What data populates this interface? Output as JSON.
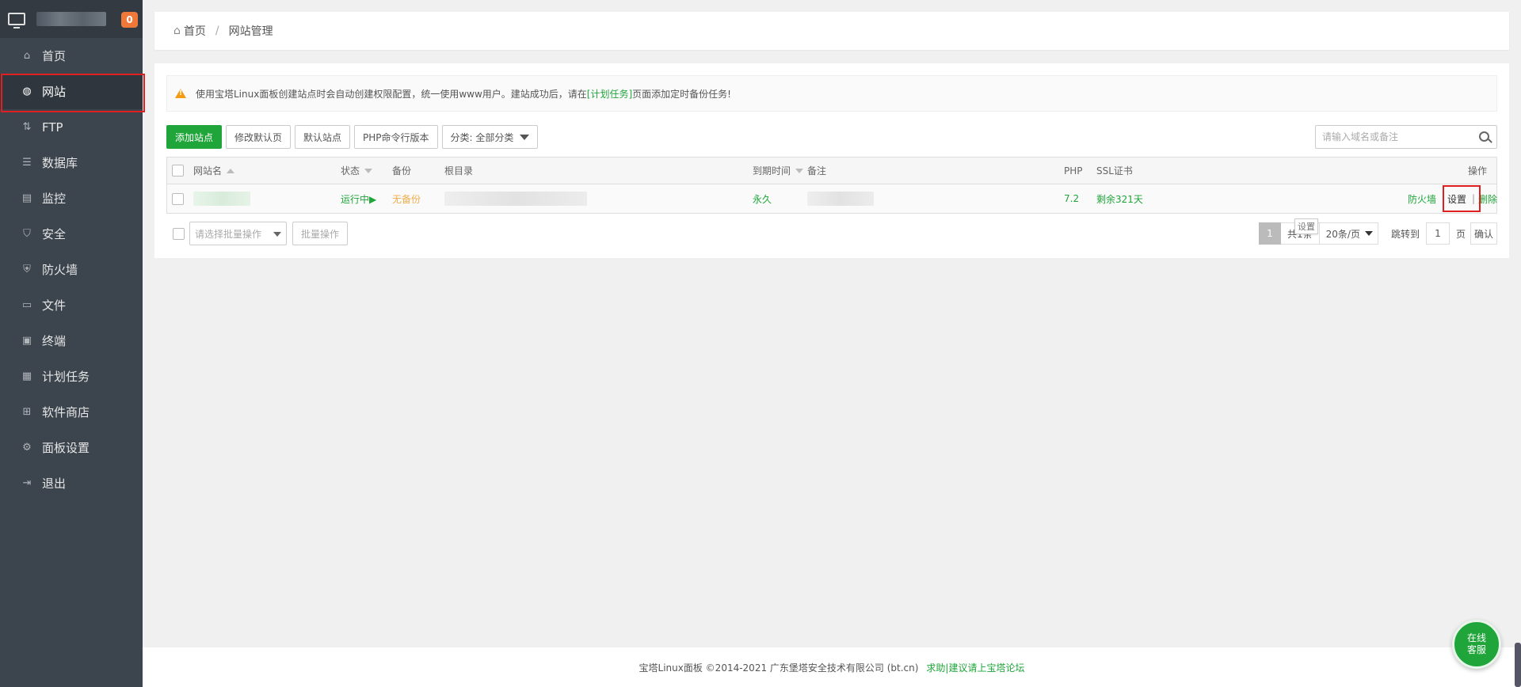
{
  "sidebar": {
    "badge_count": "0",
    "items": [
      {
        "label": "首页",
        "icon": "home-icon"
      },
      {
        "label": "网站",
        "icon": "globe-icon"
      },
      {
        "label": "FTP",
        "icon": "ftp-icon"
      },
      {
        "label": "数据库",
        "icon": "database-icon"
      },
      {
        "label": "监控",
        "icon": "monitor-icon"
      },
      {
        "label": "安全",
        "icon": "shield-icon"
      },
      {
        "label": "防火墙",
        "icon": "firewall-icon"
      },
      {
        "label": "文件",
        "icon": "folder-icon"
      },
      {
        "label": "终端",
        "icon": "terminal-icon"
      },
      {
        "label": "计划任务",
        "icon": "calendar-icon"
      },
      {
        "label": "软件商店",
        "icon": "grid-icon"
      },
      {
        "label": "面板设置",
        "icon": "gear-icon"
      },
      {
        "label": "退出",
        "icon": "logout-icon"
      }
    ]
  },
  "breadcrumb": {
    "home": "首页",
    "sep": "/",
    "current": "网站管理"
  },
  "notice": {
    "text_before": "使用宝塔Linux面板创建站点时会自动创建权限配置，统一使用www用户。建站成功后，请在",
    "link": "[计划任务]",
    "text_after": "页面添加定时备份任务!"
  },
  "toolbar": {
    "add_site": "添加站点",
    "edit_default_page": "修改默认页",
    "default_site": "默认站点",
    "php_cli_version": "PHP命令行版本",
    "category": "分类: 全部分类"
  },
  "search": {
    "placeholder": "请输入域名或备注"
  },
  "table": {
    "headers": {
      "name": "网站名",
      "status": "状态",
      "backup": "备份",
      "root": "根目录",
      "expire": "到期时间",
      "remark": "备注",
      "php": "PHP",
      "ssl": "SSL证书",
      "actions": "操作"
    },
    "rows": [
      {
        "status": "运行中▶",
        "backup": "无备份",
        "expire": "永久",
        "php": "7.2",
        "ssl": "剩余321天",
        "firewall": "防火墙",
        "settings": "设置",
        "divider": "|",
        "delete": "删除"
      }
    ]
  },
  "tooltip": "设置",
  "bulk": {
    "select_placeholder": "请选择批量操作",
    "button": "批量操作"
  },
  "pager": {
    "current": "1",
    "total": "共1条",
    "per_page": "20条/页",
    "jump_label": "跳转到",
    "jump_value": "1",
    "page_unit": "页",
    "confirm": "确认"
  },
  "footer": {
    "copyright": "宝塔Linux面板 ©2014-2021 广东堡塔安全技术有限公司 (bt.cn)",
    "link": "求助|建议请上宝塔论坛"
  },
  "online_service": "在线客服",
  "colors": {
    "accent": "#20a53a",
    "sidebar": "#3c444d",
    "highlight": "#e02020",
    "warning": "#f0ad4e"
  }
}
